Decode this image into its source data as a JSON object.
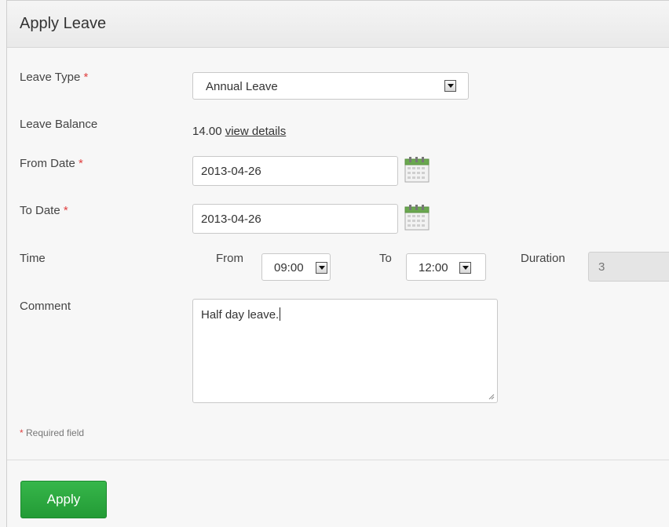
{
  "header": {
    "title": "Apply Leave"
  },
  "form": {
    "leave_type": {
      "label": "Leave Type ",
      "required_mark": "*",
      "selected": "Annual Leave"
    },
    "leave_balance": {
      "label": "Leave Balance",
      "value": "14.00",
      "link": "view details"
    },
    "from_date": {
      "label": "From Date ",
      "required_mark": "*",
      "value": "2013-04-26"
    },
    "to_date": {
      "label": "To Date ",
      "required_mark": "*",
      "value": "2013-04-26"
    },
    "time": {
      "label": "Time",
      "from_label": "From",
      "from_value": "09:00",
      "to_label": "To",
      "to_value": "12:00",
      "duration_label": "Duration",
      "duration_value": "3"
    },
    "comment": {
      "label": "Comment",
      "value": "Half day leave."
    },
    "required_note": {
      "mark": "*",
      "text": " Required field"
    },
    "apply_label": "Apply"
  },
  "icons": {
    "calendar": "calendar-icon",
    "dropdown": "chevron-down-icon",
    "resize": "resize-grip-icon"
  },
  "colors": {
    "apply": "#2aa63d",
    "required": "#e03f3f",
    "calendar_top": "#6aa84f"
  }
}
